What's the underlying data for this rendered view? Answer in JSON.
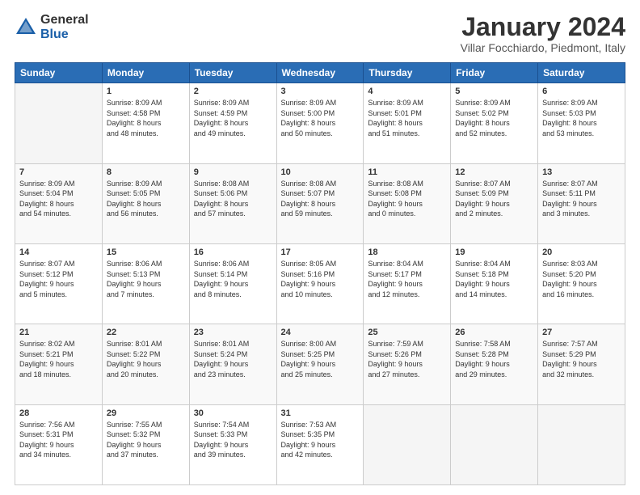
{
  "logo": {
    "general": "General",
    "blue": "Blue"
  },
  "title": "January 2024",
  "location": "Villar Focchiardo, Piedmont, Italy",
  "weekdays": [
    "Sunday",
    "Monday",
    "Tuesday",
    "Wednesday",
    "Thursday",
    "Friday",
    "Saturday"
  ],
  "weeks": [
    [
      {
        "day": "",
        "info": ""
      },
      {
        "day": "1",
        "info": "Sunrise: 8:09 AM\nSunset: 4:58 PM\nDaylight: 8 hours\nand 48 minutes."
      },
      {
        "day": "2",
        "info": "Sunrise: 8:09 AM\nSunset: 4:59 PM\nDaylight: 8 hours\nand 49 minutes."
      },
      {
        "day": "3",
        "info": "Sunrise: 8:09 AM\nSunset: 5:00 PM\nDaylight: 8 hours\nand 50 minutes."
      },
      {
        "day": "4",
        "info": "Sunrise: 8:09 AM\nSunset: 5:01 PM\nDaylight: 8 hours\nand 51 minutes."
      },
      {
        "day": "5",
        "info": "Sunrise: 8:09 AM\nSunset: 5:02 PM\nDaylight: 8 hours\nand 52 minutes."
      },
      {
        "day": "6",
        "info": "Sunrise: 8:09 AM\nSunset: 5:03 PM\nDaylight: 8 hours\nand 53 minutes."
      }
    ],
    [
      {
        "day": "7",
        "info": "Sunrise: 8:09 AM\nSunset: 5:04 PM\nDaylight: 8 hours\nand 54 minutes."
      },
      {
        "day": "8",
        "info": "Sunrise: 8:09 AM\nSunset: 5:05 PM\nDaylight: 8 hours\nand 56 minutes."
      },
      {
        "day": "9",
        "info": "Sunrise: 8:08 AM\nSunset: 5:06 PM\nDaylight: 8 hours\nand 57 minutes."
      },
      {
        "day": "10",
        "info": "Sunrise: 8:08 AM\nSunset: 5:07 PM\nDaylight: 8 hours\nand 59 minutes."
      },
      {
        "day": "11",
        "info": "Sunrise: 8:08 AM\nSunset: 5:08 PM\nDaylight: 9 hours\nand 0 minutes."
      },
      {
        "day": "12",
        "info": "Sunrise: 8:07 AM\nSunset: 5:09 PM\nDaylight: 9 hours\nand 2 minutes."
      },
      {
        "day": "13",
        "info": "Sunrise: 8:07 AM\nSunset: 5:11 PM\nDaylight: 9 hours\nand 3 minutes."
      }
    ],
    [
      {
        "day": "14",
        "info": "Sunrise: 8:07 AM\nSunset: 5:12 PM\nDaylight: 9 hours\nand 5 minutes."
      },
      {
        "day": "15",
        "info": "Sunrise: 8:06 AM\nSunset: 5:13 PM\nDaylight: 9 hours\nand 7 minutes."
      },
      {
        "day": "16",
        "info": "Sunrise: 8:06 AM\nSunset: 5:14 PM\nDaylight: 9 hours\nand 8 minutes."
      },
      {
        "day": "17",
        "info": "Sunrise: 8:05 AM\nSunset: 5:16 PM\nDaylight: 9 hours\nand 10 minutes."
      },
      {
        "day": "18",
        "info": "Sunrise: 8:04 AM\nSunset: 5:17 PM\nDaylight: 9 hours\nand 12 minutes."
      },
      {
        "day": "19",
        "info": "Sunrise: 8:04 AM\nSunset: 5:18 PM\nDaylight: 9 hours\nand 14 minutes."
      },
      {
        "day": "20",
        "info": "Sunrise: 8:03 AM\nSunset: 5:20 PM\nDaylight: 9 hours\nand 16 minutes."
      }
    ],
    [
      {
        "day": "21",
        "info": "Sunrise: 8:02 AM\nSunset: 5:21 PM\nDaylight: 9 hours\nand 18 minutes."
      },
      {
        "day": "22",
        "info": "Sunrise: 8:01 AM\nSunset: 5:22 PM\nDaylight: 9 hours\nand 20 minutes."
      },
      {
        "day": "23",
        "info": "Sunrise: 8:01 AM\nSunset: 5:24 PM\nDaylight: 9 hours\nand 23 minutes."
      },
      {
        "day": "24",
        "info": "Sunrise: 8:00 AM\nSunset: 5:25 PM\nDaylight: 9 hours\nand 25 minutes."
      },
      {
        "day": "25",
        "info": "Sunrise: 7:59 AM\nSunset: 5:26 PM\nDaylight: 9 hours\nand 27 minutes."
      },
      {
        "day": "26",
        "info": "Sunrise: 7:58 AM\nSunset: 5:28 PM\nDaylight: 9 hours\nand 29 minutes."
      },
      {
        "day": "27",
        "info": "Sunrise: 7:57 AM\nSunset: 5:29 PM\nDaylight: 9 hours\nand 32 minutes."
      }
    ],
    [
      {
        "day": "28",
        "info": "Sunrise: 7:56 AM\nSunset: 5:31 PM\nDaylight: 9 hours\nand 34 minutes."
      },
      {
        "day": "29",
        "info": "Sunrise: 7:55 AM\nSunset: 5:32 PM\nDaylight: 9 hours\nand 37 minutes."
      },
      {
        "day": "30",
        "info": "Sunrise: 7:54 AM\nSunset: 5:33 PM\nDaylight: 9 hours\nand 39 minutes."
      },
      {
        "day": "31",
        "info": "Sunrise: 7:53 AM\nSunset: 5:35 PM\nDaylight: 9 hours\nand 42 minutes."
      },
      {
        "day": "",
        "info": ""
      },
      {
        "day": "",
        "info": ""
      },
      {
        "day": "",
        "info": ""
      }
    ]
  ]
}
